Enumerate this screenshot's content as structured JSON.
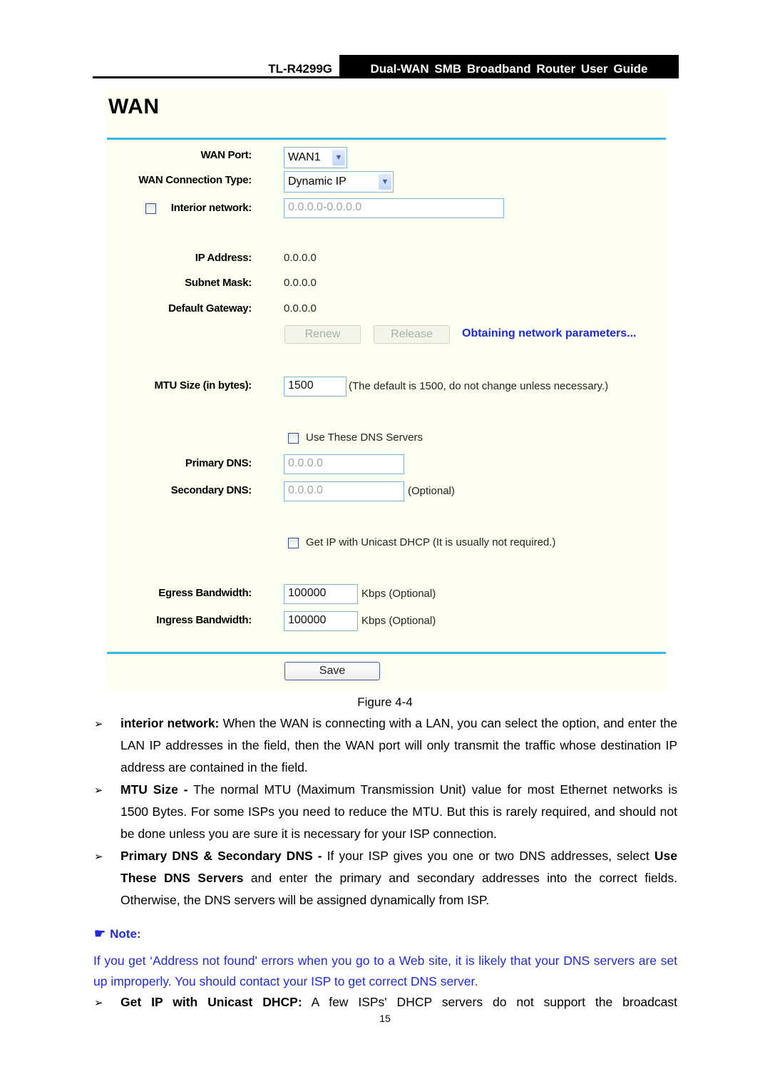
{
  "header": {
    "model": "TL-R4299G",
    "title": "Dual-WAN SMB Broadband Router User Guide"
  },
  "panel": {
    "title": "WAN",
    "wan_port": {
      "label": "WAN Port:",
      "value": "WAN1"
    },
    "connection_type": {
      "label": "WAN Connection Type:",
      "value": "Dynamic IP"
    },
    "interior_network": {
      "label": "Interior network:",
      "value": "0.0.0.0-0.0.0.0",
      "checked": false
    },
    "ip_address": {
      "label": "IP Address:",
      "value": "0.0.0.0"
    },
    "subnet_mask": {
      "label": "Subnet Mask:",
      "value": "0.0.0.0"
    },
    "default_gateway": {
      "label": "Default Gateway:",
      "value": "0.0.0.0"
    },
    "renew_label": "Renew",
    "release_label": "Release",
    "status_text": "Obtaining network parameters...",
    "mtu": {
      "label": "MTU Size (in bytes):",
      "value": "1500",
      "hint": "(The default is 1500, do not change unless necessary.)"
    },
    "use_dns": {
      "label": "Use These DNS Servers",
      "checked": false
    },
    "primary_dns": {
      "label": "Primary DNS:",
      "value": "0.0.0.0"
    },
    "secondary_dns": {
      "label": "Secondary DNS:",
      "value": "0.0.0.0",
      "hint": "(Optional)"
    },
    "unicast_dhcp": {
      "label": "Get IP with Unicast DHCP (It is usually not required.)",
      "checked": false
    },
    "egress": {
      "label": "Egress Bandwidth:",
      "value": "100000",
      "hint": "Kbps (Optional)"
    },
    "ingress": {
      "label": "Ingress Bandwidth:",
      "value": "100000",
      "hint": "Kbps (Optional)"
    },
    "save_label": "Save"
  },
  "figure_caption": "Figure 4-4",
  "bullets": [
    {
      "term": "interior network:",
      "text": " When the WAN is connecting with a LAN, you can select the option, and enter the LAN IP addresses in the field, then the WAN port will only transmit the traffic whose destination IP address are contained in the field."
    },
    {
      "term": "MTU Size -",
      "text": " The normal MTU (Maximum Transmission Unit) value for most Ethernet networks is 1500 Bytes. For some ISPs you need to reduce the MTU. But this is rarely required, and should not be done unless you are sure it is necessary for your ISP connection."
    },
    {
      "term": "Primary DNS & Secondary DNS -",
      "text": " If your ISP gives you one or two DNS addresses, select ",
      "term2": "Use These DNS Servers",
      "text2": " and enter the primary and secondary addresses into the correct fields. Otherwise, the DNS servers will be assigned dynamically from ISP."
    },
    {
      "term": "Get IP with Unicast DHCP:",
      "text": " A few ISPs' DHCP servers do not support the broadcast"
    }
  ],
  "note": {
    "heading": "Note:",
    "icon": "pointing-hand-icon",
    "text": "If you get ‘Address not found' errors when you go to a Web site, it is likely that your DNS servers are set up improperly. You should contact your ISP to get correct DNS server."
  },
  "bullet_glyph": "➢",
  "page_number": "15",
  "colors": {
    "accent_rule": "#38b6e6",
    "panel_bg": "#fdfff0",
    "status_blue": "#1f2bd8"
  }
}
